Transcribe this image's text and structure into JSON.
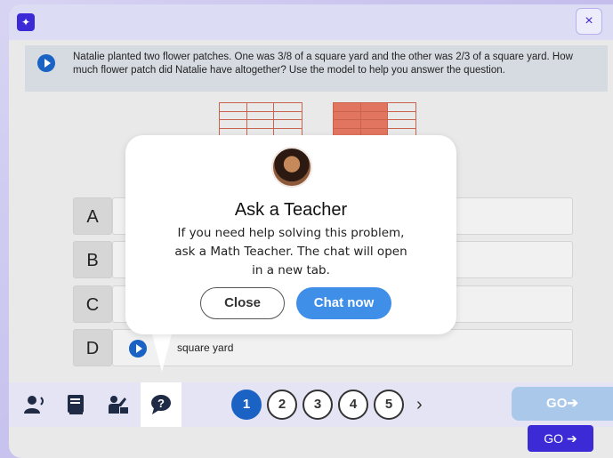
{
  "header": {
    "app_icon": "sparkle-icon",
    "close_glyph": "×"
  },
  "question": {
    "text": "Natalie planted two flower patches. One was 3/8 of a square yard and the other was 2/3 of a square yard. How much flower patch did Natalie have altogether? Use the model to help you answer the question."
  },
  "choices": [
    {
      "letter": "A",
      "text": ""
    },
    {
      "letter": "B",
      "text": ""
    },
    {
      "letter": "C",
      "text": ""
    },
    {
      "letter": "D",
      "text": "square yard"
    }
  ],
  "toolbar": {
    "tools": [
      "read-aloud-icon",
      "glossary-book-icon",
      "teacher-icon",
      "ask-teacher-chat-icon"
    ],
    "pages": [
      "1",
      "2",
      "3",
      "4",
      "5"
    ],
    "current_page": "1",
    "next_glyph": "›",
    "go_label": "GO➔"
  },
  "footer": {
    "go_label": "GO ➔"
  },
  "popup": {
    "title": "Ask a Teacher",
    "body": "If you need help solving this problem, ask a Math Teacher. The chat will open in a new tab.",
    "close_label": "Close",
    "chat_label": "Chat now"
  },
  "colors": {
    "accent": "#3b2ad6",
    "play": "#1a62c4",
    "chat_button": "#3f8fe8",
    "grid_fill": "#e17560"
  }
}
